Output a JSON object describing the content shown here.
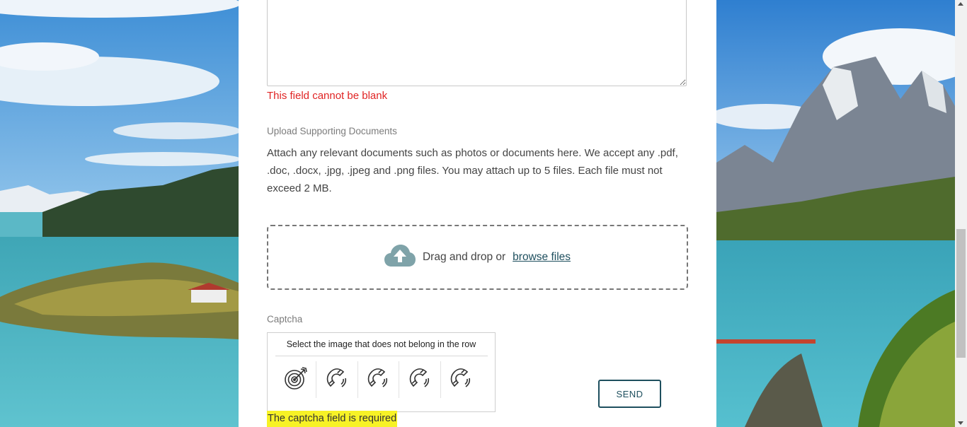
{
  "form": {
    "message_error": "This field cannot be blank",
    "upload": {
      "label": "Upload Supporting Documents",
      "description": "Attach any relevant documents such as photos or documents here. We accept any .pdf, .doc, .docx, .jpg, .jpeg and .png files. You may attach up to 5 files. Each file must not exceed 2 MB.",
      "drop_text": "Drag and drop or",
      "browse_link": "browse files",
      "icon": "cloud-upload-icon"
    },
    "captcha": {
      "label": "Captcha",
      "instruction": "Select the image that does not belong in the row",
      "options": [
        "target-icon",
        "magnet-icon",
        "magnet-icon",
        "magnet-icon",
        "magnet-icon"
      ],
      "error": "The captcha field is required"
    },
    "send_label": "SEND"
  },
  "colors": {
    "error": "#e02424",
    "accent": "#1e4f5e",
    "highlight": "#f7f226"
  }
}
